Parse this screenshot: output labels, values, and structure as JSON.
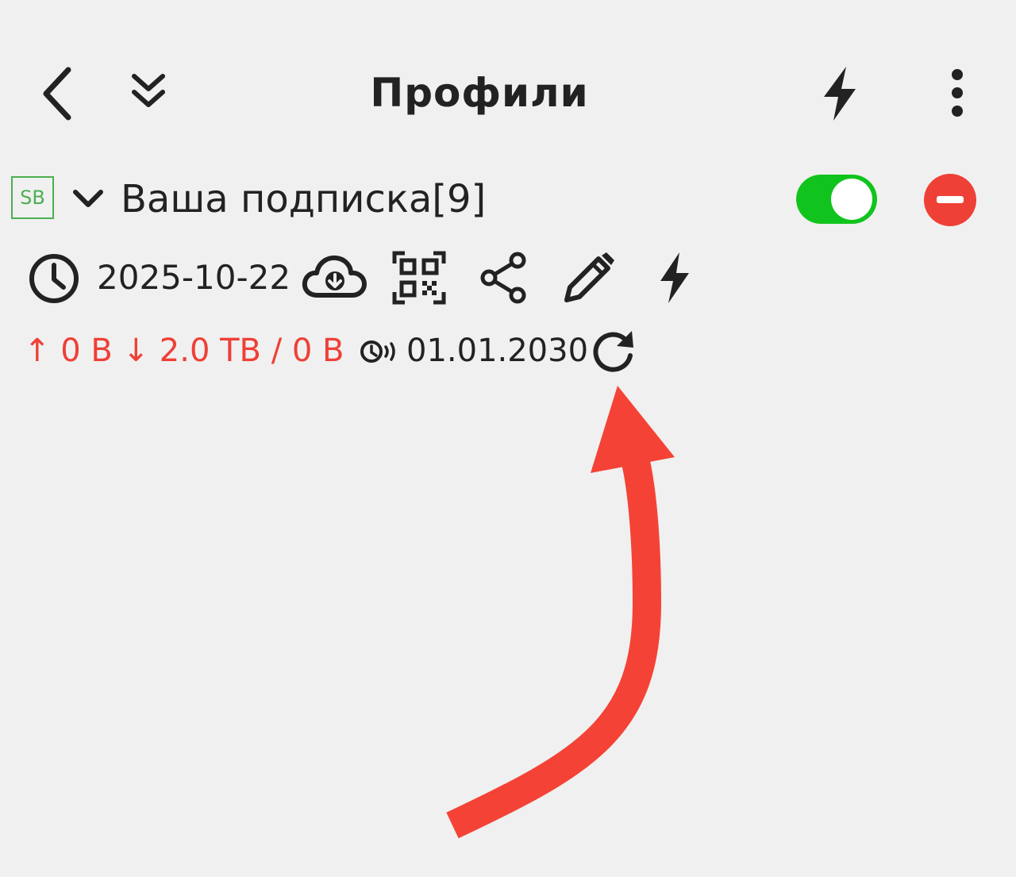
{
  "header": {
    "title": "Профили",
    "back_icon": "chevron-left-icon",
    "collapse_icon": "double-chevron-down-icon",
    "connect_icon": "lightning-icon",
    "menu_icon": "more-vert-icon"
  },
  "profile": {
    "badge": "SB",
    "name": "Ваша подписка[9]",
    "enabled": true,
    "last_update_date": "2025-10-22",
    "traffic": "↑ 0 B ↓ 2.0 TB / 0 B",
    "expire_date": "01.01.2030",
    "actions": [
      "download-cloud-icon",
      "qr-code-icon",
      "share-icon",
      "edit-pencil-icon",
      "lightning-icon"
    ]
  },
  "colors": {
    "background": "#f0f0f0",
    "text": "#222222",
    "badge_green": "#4caf50",
    "toggle_on": "#11c41d",
    "remove_red": "#ee4036",
    "traffic_red": "#ee4036",
    "annotation_arrow": "#f44336"
  }
}
